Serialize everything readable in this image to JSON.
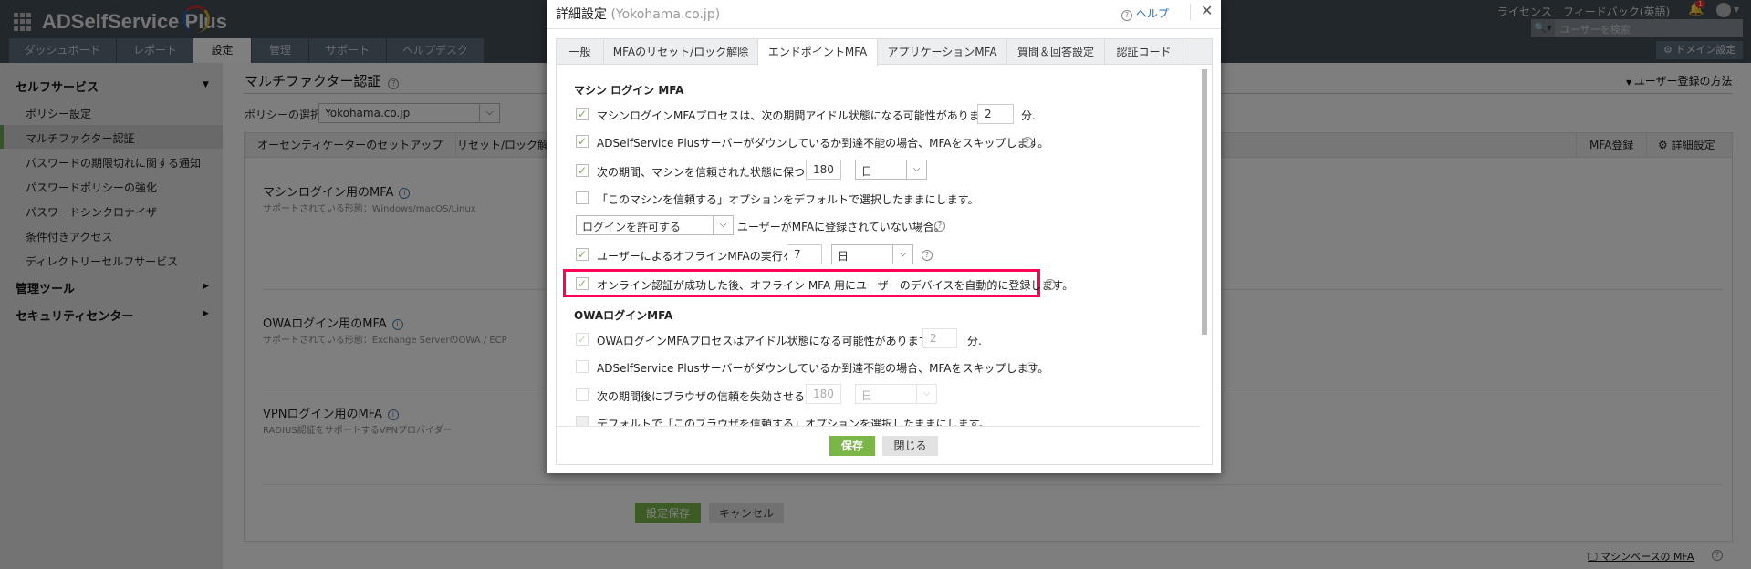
{
  "header": {
    "app_name": "ADSelfService Plus",
    "nav_tabs": [
      "ダッシュボード",
      "レポート",
      "設定",
      "管理",
      "サポート",
      "ヘルプデスク"
    ],
    "active_tab": "設定",
    "license": "ライセンス",
    "feedback": "フィードバック(英語)",
    "notification_count": "1",
    "search_placeholder": "ユーザーを検索",
    "domain_settings": "ドメイン設定"
  },
  "sidebar": {
    "self_service": "セルフサービス",
    "items": [
      "ポリシー設定",
      "マルチファクター認証",
      "パスワードの期限切れに関する通知",
      "パスワードポリシーの強化",
      "パスワードシンクロナイザ",
      "条件付きアクセス",
      "ディレクトリーセルフサービス"
    ],
    "admin_tools": "管理ツール",
    "security_center": "セキュリティセンター"
  },
  "main": {
    "title": "マルチファクター認証",
    "enroll_method": "ユーザー登録の方法",
    "policy_label": "ポリシーの選択",
    "policy_value": "Yokohama.co.jp",
    "tabs": [
      "オーセンティケーターのセットアップ",
      "リセット/ロック解除"
    ],
    "right_tabs": [
      "MFA登録",
      "詳細設定"
    ],
    "sections": [
      {
        "title": "マシンログイン用のMFA",
        "sub": "サポートされている形態：Windows/macOS/Linux"
      },
      {
        "title": "OWAログイン用のMFA",
        "sub": "サポートされている形態：Exchange ServerのOWA / ECP"
      },
      {
        "title": "VPNログイン用のMFA",
        "sub": "RADIUS認証をサポートするVPNプロバイダー"
      }
    ],
    "save": "設定保存",
    "cancel": "キャンセル",
    "machine_link": "マシンベースの MFA"
  },
  "dialog": {
    "title": "詳細設定",
    "subtitle": "(Yokohama.co.jp)",
    "help": "ヘルプ",
    "tabs": [
      "一般",
      "MFAのリセット/ロック解除",
      "エンドポイントMFA",
      "アプリケーションMFA",
      "質問＆回答設定",
      "認証コード"
    ],
    "active_tab": "エンドポイントMFA",
    "machine_heading": "マシン ログイン MFA",
    "m1": {
      "checked": true,
      "text": "マシンログインMFAプロセスは、次の期間アイドル状態になる可能性があります：",
      "value": "2",
      "unit": "分."
    },
    "m2": {
      "checked": true,
      "text": "ADSelfService Plusサーバーがダウンしているか到達不能の場合、MFAをスキップします。"
    },
    "m3": {
      "checked": true,
      "text": "次の期間、マシンを信頼された状態に保つ：",
      "value": "180",
      "unit": "日"
    },
    "m4": {
      "checked": false,
      "text": "「このマシンを信頼する」オプションをデフォルトで選択したままにします。"
    },
    "m5": {
      "select": "ログインを許可する",
      "text": "ユーザーがMFAに登録されていない場合。"
    },
    "m6": {
      "checked": true,
      "text": "ユーザーによるオフラインMFAの実行を",
      "value": "7",
      "unit": "日"
    },
    "m7": {
      "checked": true,
      "text": "オンライン認証が成功した後、オフライン MFA 用にユーザーのデバイスを自動的に登録します。"
    },
    "owa_heading": "OWAログインMFA",
    "o1": {
      "checked": true,
      "text": "OWAログインMFAプロセスはアイドル状態になる可能性があります。",
      "value": "2",
      "unit": "分."
    },
    "o2": {
      "checked": false,
      "text": "ADSelfService Plusサーバーがダウンしているか到達不能の場合、MFAをスキップします。"
    },
    "o3": {
      "checked": false,
      "text": "次の期間後にブラウザの信頼を失効させる：",
      "value": "180",
      "unit": "日"
    },
    "o4": {
      "checked": false,
      "text": "デフォルトで「このブラウザを信頼する」オプションを選択したままにします。"
    },
    "save": "保存",
    "close": "閉じる"
  },
  "colors": {
    "accent_green": "#7ab648",
    "highlight": "#ff0055"
  }
}
